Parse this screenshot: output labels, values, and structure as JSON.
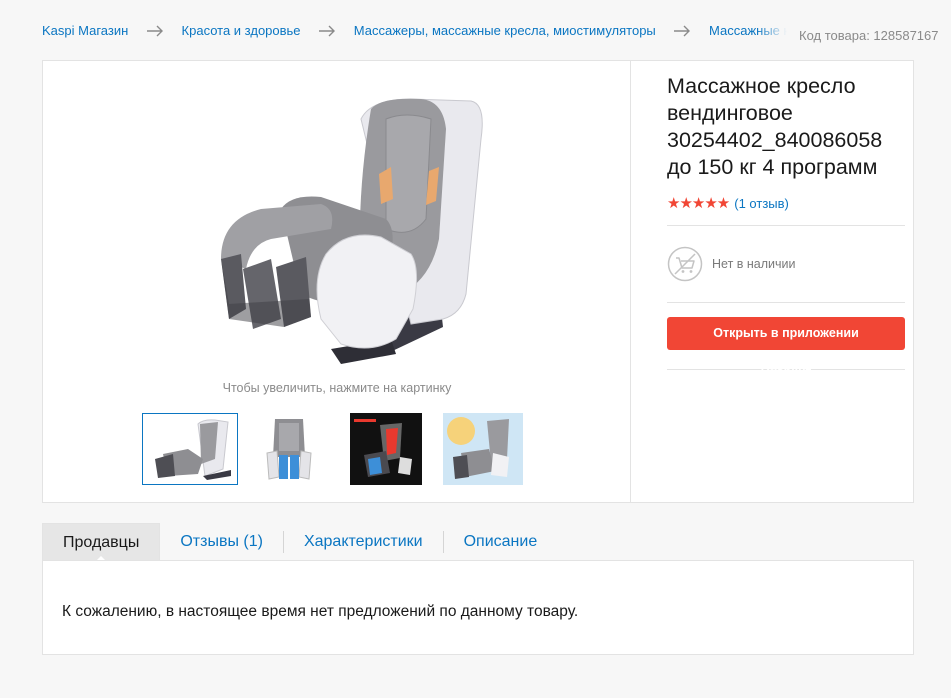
{
  "breadcrumb": {
    "items": [
      "Kaspi Магазин",
      "Красота и здоровье",
      "Массажеры, массажные кресла, миостимуляторы",
      "Массажные кресла"
    ]
  },
  "sku": "Код товара: 128587167",
  "product": {
    "title_lines": [
      "Массажное кресло",
      "вендинговое",
      "30254402_840086058",
      "до 150 кг 4 программ"
    ],
    "rating_stars": 5,
    "rating_stars_text": "★★★★★",
    "reviews_link": "(1 отзыв)",
    "stock_status": "Нет в наличии",
    "open_app_button": "Открыть в приложении Kaspi.kz"
  },
  "gallery": {
    "zoom_hint": "Чтобы увеличить, нажмите на картинку",
    "thumbnails": [
      "chair-side-view",
      "chair-front-view",
      "chair-features",
      "chair-lifestyle"
    ],
    "selected_index": 0
  },
  "tabs": {
    "items": [
      "Продавцы",
      "Отзывы (1)",
      "Характеристики",
      "Описание"
    ],
    "active_index": 0
  },
  "sellers": {
    "empty_message": "К сожалению, в настоящее время нет предложений по данному товару."
  },
  "colors": {
    "link": "#0b76c2",
    "accent_red": "#f14635",
    "background": "#f7f7f7"
  }
}
